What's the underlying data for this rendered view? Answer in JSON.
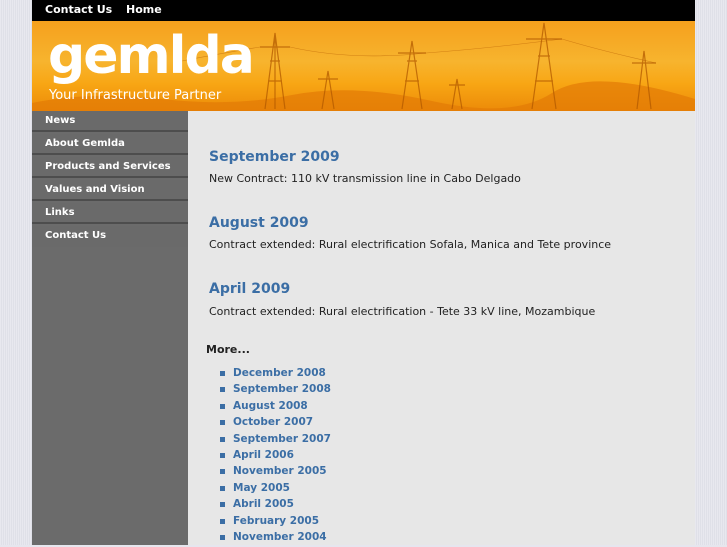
{
  "topnav": {
    "contact": "Contact Us",
    "home": "Home"
  },
  "banner": {
    "logo": "gemlda",
    "tagline": "Your Infrastructure Partner"
  },
  "sidebar": {
    "items": [
      {
        "label": "News"
      },
      {
        "label": "About Gemlda"
      },
      {
        "label": "Products and Services"
      },
      {
        "label": "Values and Vision"
      },
      {
        "label": "Links"
      },
      {
        "label": "Contact Us"
      }
    ]
  },
  "news": [
    {
      "title": "September 2009",
      "text": "New Contract: 110 kV transmission line in Cabo Delgado"
    },
    {
      "title": "August 2009",
      "text": "Contract extended: Rural electrification Sofala, Manica and Tete province"
    },
    {
      "title": "April 2009",
      "text": "Contract extended: Rural electrification - Tete 33 kV line, Mozambique"
    }
  ],
  "more_label": "More...",
  "archive": [
    "December 2008",
    "September 2008",
    "August 2008",
    "October 2007",
    "September 2007",
    "April 2006",
    "November 2005",
    "May 2005",
    "Abril 2005",
    "February 2005",
    "November 2004"
  ],
  "colors": {
    "accent": "#3b6ea5",
    "banner": "#f5a01d",
    "sidebar": "#6b6b6b"
  }
}
